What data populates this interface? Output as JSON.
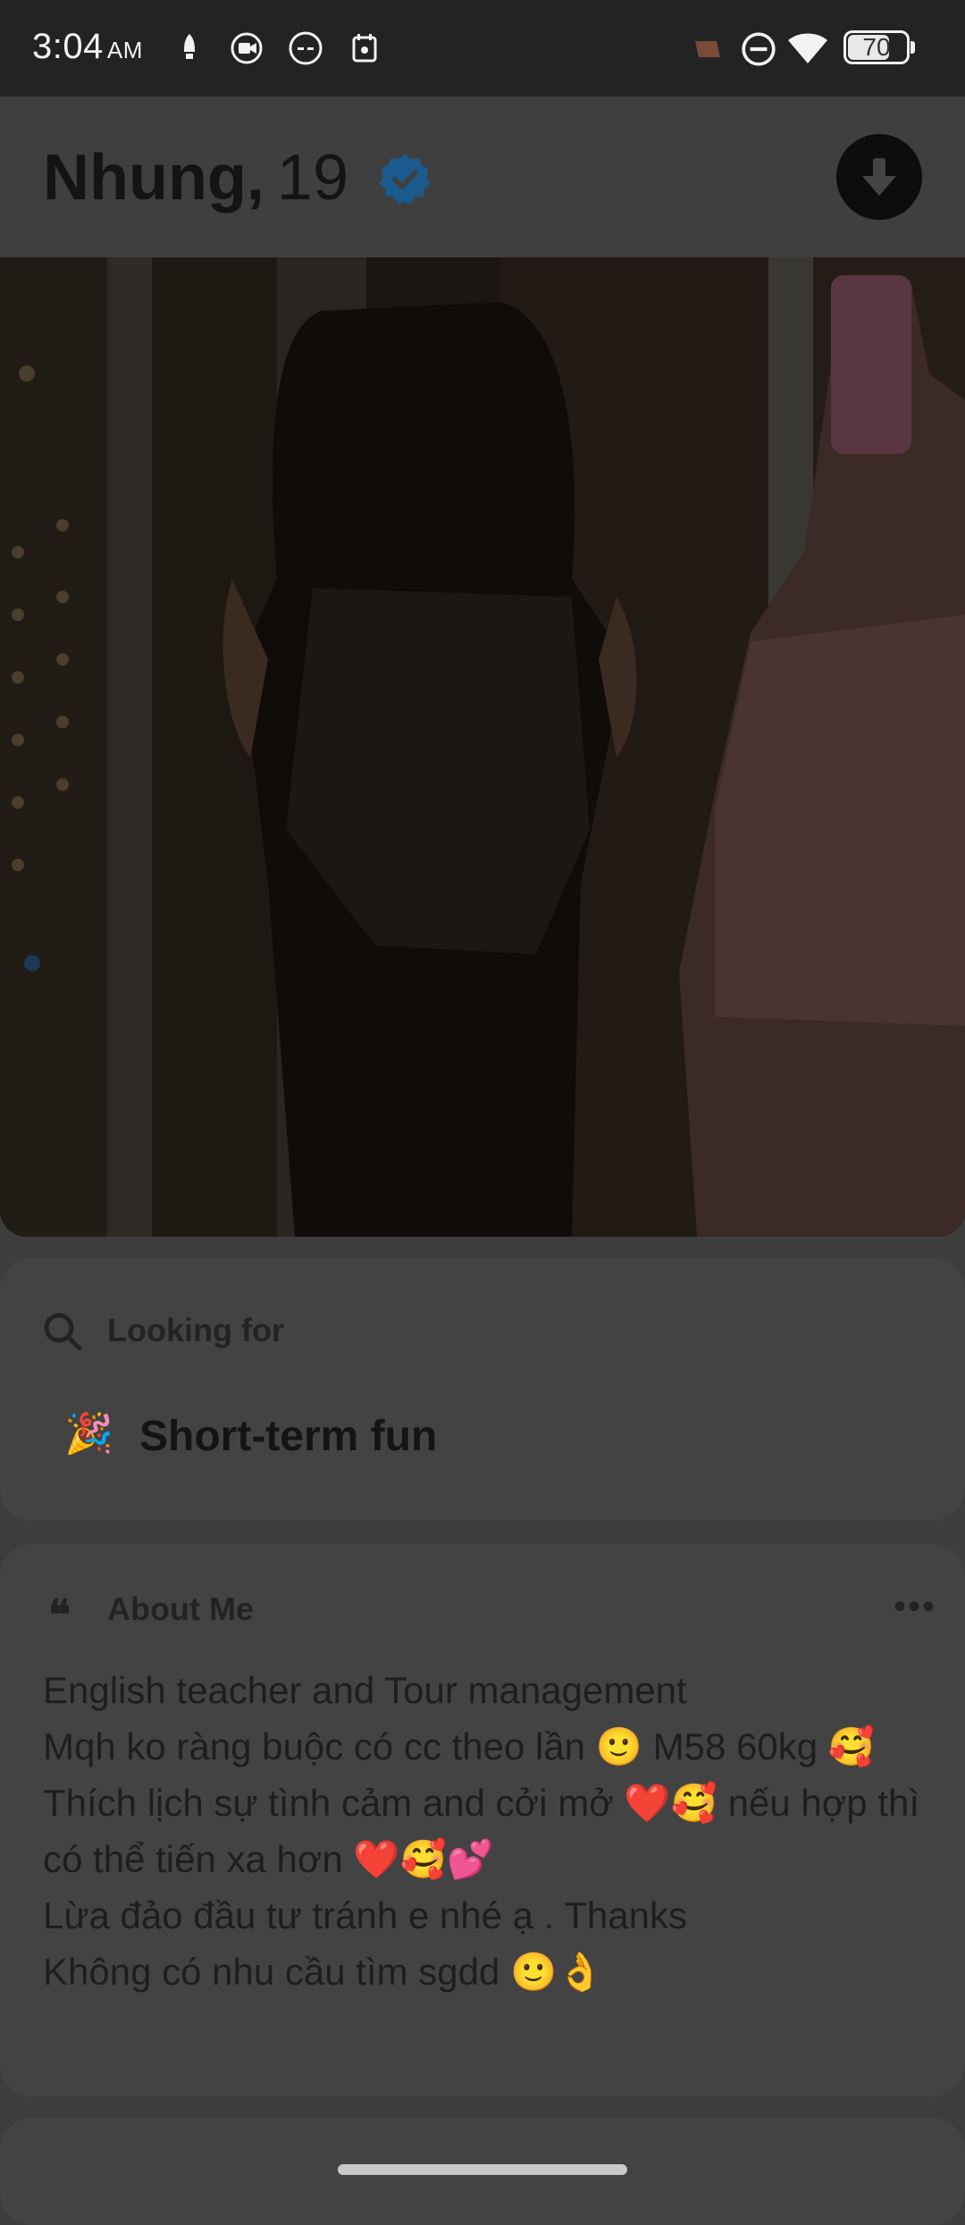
{
  "status_bar": {
    "time": "3:04",
    "ampm": "AM",
    "battery": "70",
    "icons": [
      "notification-icon",
      "screen-record-icon",
      "dots-icon",
      "calendar-icon",
      "cast-icon",
      "do-not-disturb-icon",
      "wifi-icon",
      "battery-icon"
    ]
  },
  "profile": {
    "name": "Nhung,",
    "age": "19",
    "verified": true
  },
  "looking_for": {
    "label": "Looking for",
    "emoji": "🎉",
    "value": "Short-term fun"
  },
  "about": {
    "label": "About Me",
    "text": "English teacher and Tour management\nMqh ko ràng buộc có cc theo lần  🙂 M58 60kg 🥰\nThích lịch sự tình cảm and cởi mở ❤️🥰 nếu hợp thì có thể tiến xa hơn ❤️🥰💕\nLừa đảo đầu tư tránh e nhé ạ . Thanks\nKhông có nhu cầu tìm sgdd 🙂👌"
  },
  "colors": {
    "overlay": "#3d3d3d",
    "verified": "#1b5a8c",
    "status_bar": "#232323"
  }
}
